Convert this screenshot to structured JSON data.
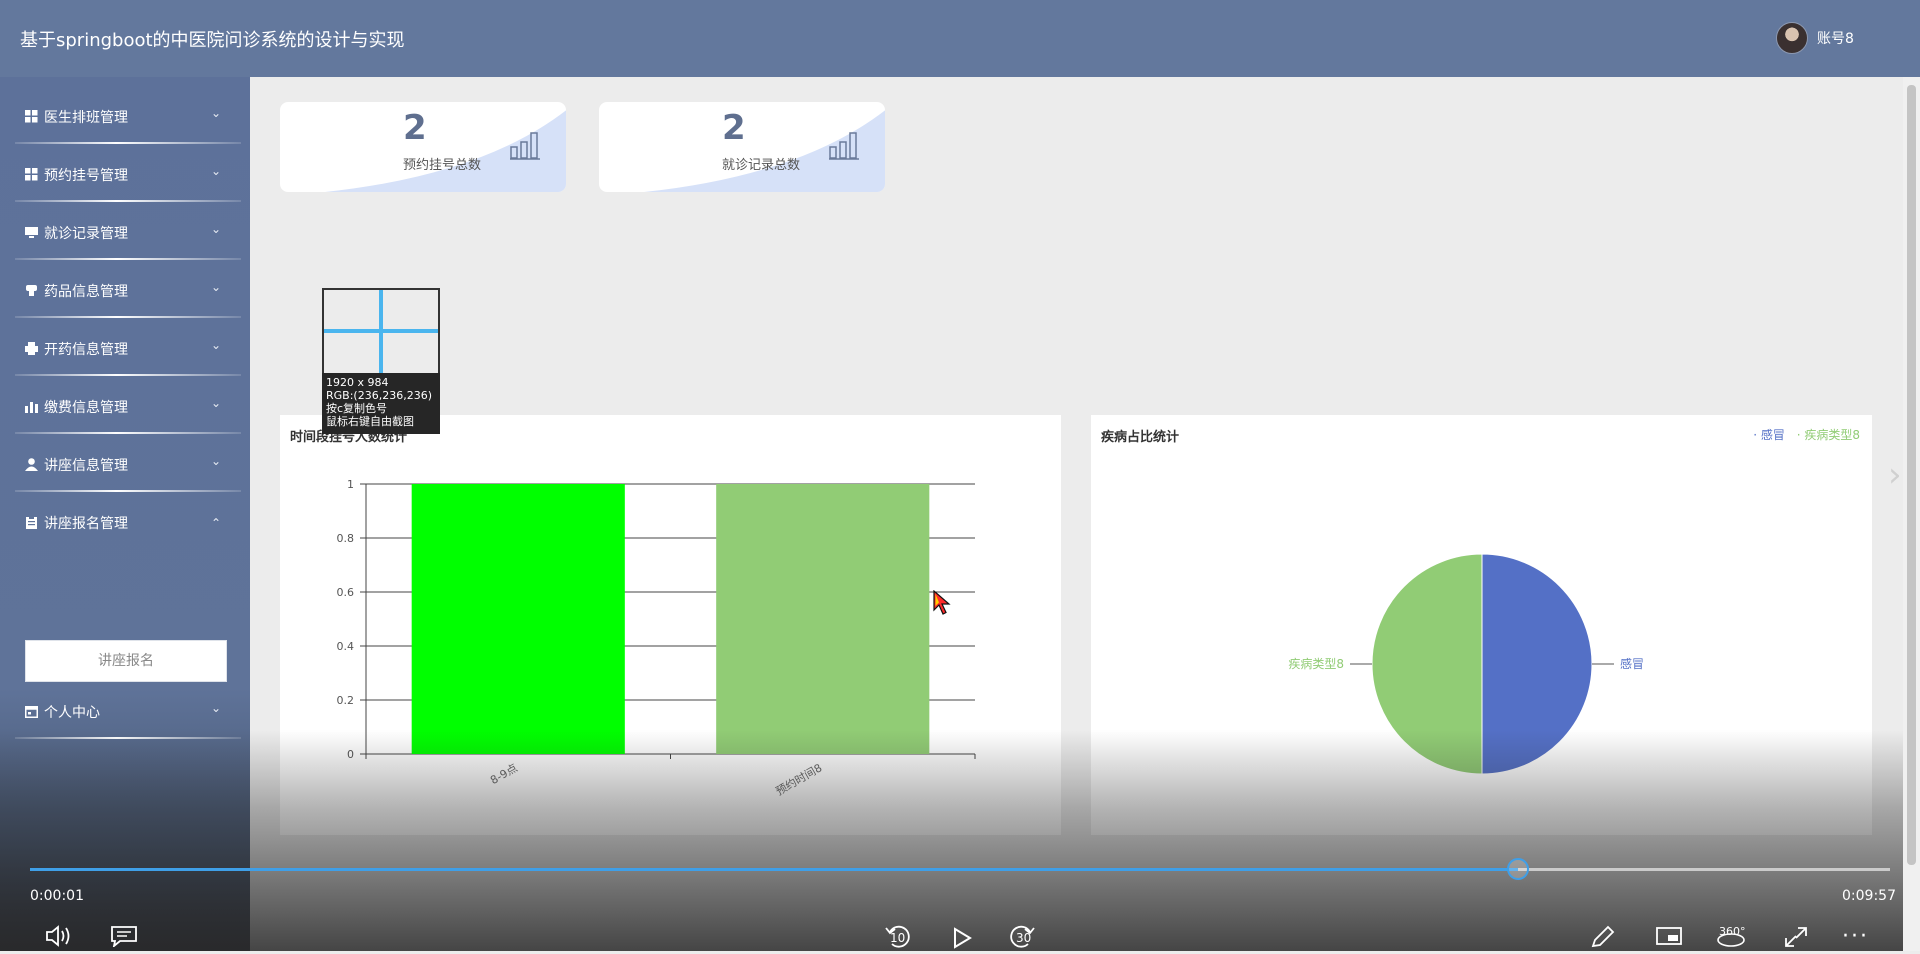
{
  "header": {
    "title": "基于springboot的中医院问诊系统的设计与实现",
    "account": "账号8"
  },
  "sidebar": {
    "items": [
      {
        "label": "医生排班管理",
        "icon": "grid-icon",
        "expanded": false
      },
      {
        "label": "预约挂号管理",
        "icon": "grid-icon",
        "expanded": false
      },
      {
        "label": "就诊记录管理",
        "icon": "monitor-icon",
        "expanded": false
      },
      {
        "label": "药品信息管理",
        "icon": "pill-icon",
        "expanded": false
      },
      {
        "label": "开药信息管理",
        "icon": "printer-icon",
        "expanded": false
      },
      {
        "label": "缴费信息管理",
        "icon": "chart-icon",
        "expanded": false
      },
      {
        "label": "讲座信息管理",
        "icon": "user-icon",
        "expanded": false
      },
      {
        "label": "讲座报名管理",
        "icon": "clipboard-icon",
        "expanded": true
      },
      {
        "label": "个人中心",
        "icon": "calendar-icon",
        "expanded": false
      }
    ],
    "sub_item": "讲座报名"
  },
  "stats": [
    {
      "value": "2",
      "label": "预约挂号总数"
    },
    {
      "value": "2",
      "label": "就诊记录总数"
    }
  ],
  "screenshot_tool": {
    "line1": "1920 x 984",
    "line2": "RGB:(236,236,236)",
    "line3": "按c复制色号",
    "line4": "鼠标右键自由截图",
    "magnifier_color": "#ececec"
  },
  "bar_panel": {
    "title": "时间段挂号人数统计"
  },
  "pie_panel": {
    "title": "疾病占比统计"
  },
  "chart_data": [
    {
      "type": "bar",
      "title": "时间段挂号人数统计",
      "categories": [
        "8-9点",
        "预约时间8"
      ],
      "values": [
        1,
        1
      ],
      "colors": [
        "#00ff00",
        "#91cc75"
      ],
      "ylim": [
        0,
        1
      ],
      "yticks": [
        "0",
        "0.2",
        "0.4",
        "0.6",
        "0.8",
        "1"
      ],
      "grid": true
    },
    {
      "type": "pie",
      "title": "疾病占比统计",
      "labels": [
        "感冒",
        "疾病类型8"
      ],
      "values": [
        1,
        1
      ],
      "colors": [
        "#5470c6",
        "#91cc75"
      ],
      "legend": "top-right"
    }
  ],
  "player": {
    "current_time": "0:00:01",
    "duration": "0:09:57",
    "progress": 0.8,
    "rewind_label": "10",
    "forward_label": "30"
  },
  "colors": {
    "header": "#63789d",
    "sidebar": "#5f7399",
    "accent": "#3f9fe8"
  }
}
